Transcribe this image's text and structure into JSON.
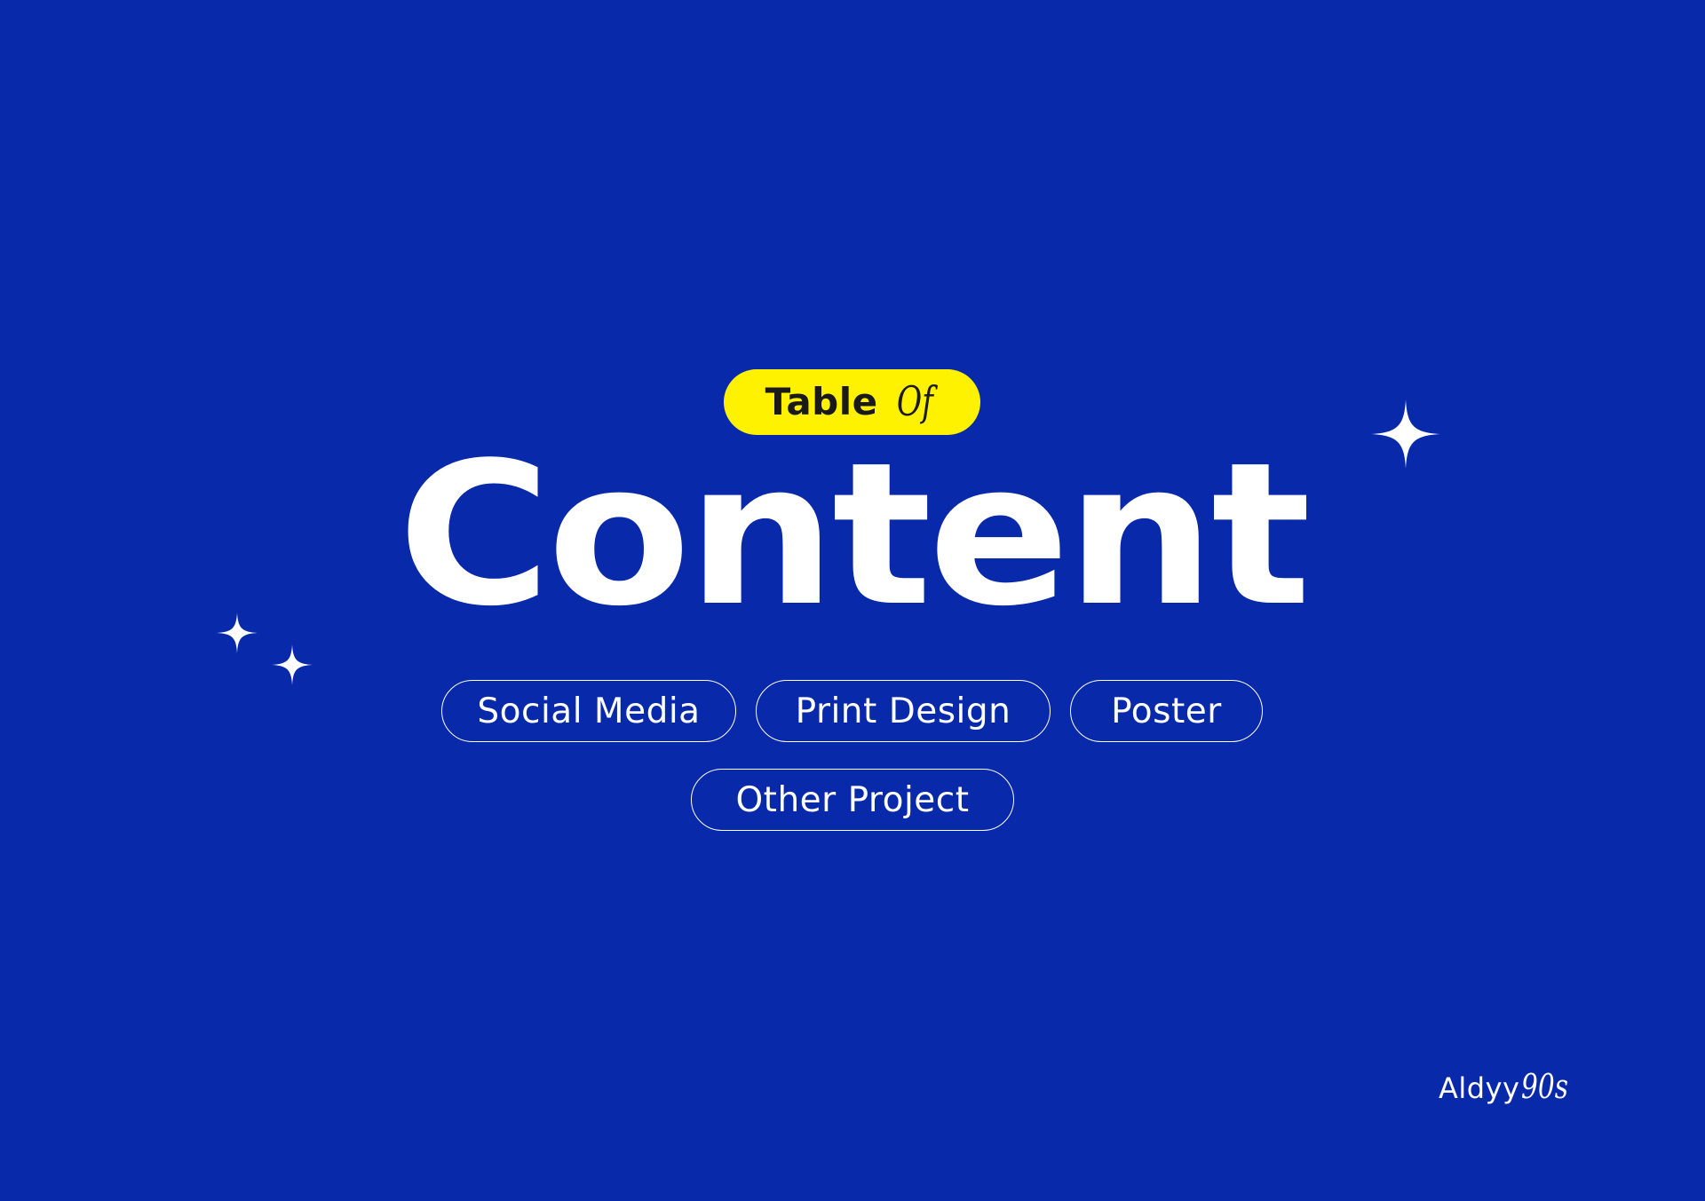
{
  "badge": {
    "word": "Table",
    "script": "Of"
  },
  "title": "Content",
  "categories": [
    {
      "label": "Social Media"
    },
    {
      "label": "Print Design"
    },
    {
      "label": "Poster"
    },
    {
      "label": "Other Project"
    }
  ],
  "signature": {
    "word": "Aldyy",
    "script": "90s"
  },
  "icons": {
    "sparkle_large": "sparkle-icon",
    "sparkle_small_1": "sparkle-icon",
    "sparkle_small_2": "sparkle-icon"
  },
  "colors": {
    "background": "#0829AA",
    "badge": "#FFF200",
    "badge_text": "#1A1A1A",
    "text": "#FFFFFF"
  }
}
